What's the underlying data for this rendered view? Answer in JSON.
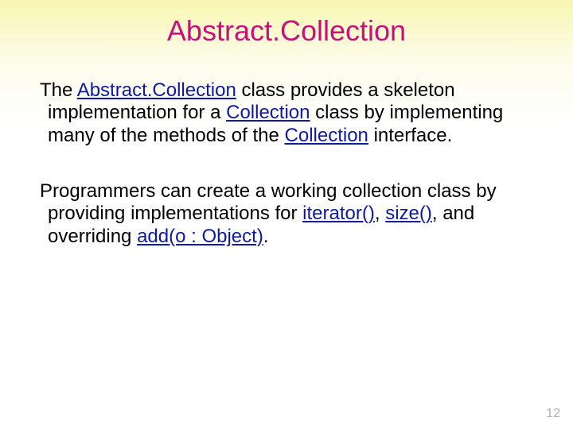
{
  "title": "Abstract.Collection",
  "para1": {
    "t1": "The ",
    "abstractcollection": "Abstract.Collection",
    "t2": " class provides a skeleton implementation for a ",
    "collection1": "Collection",
    "t3": " class by implementing many of the methods of the ",
    "collection2": "Collection",
    "t4": " interface."
  },
  "para2": {
    "t1": "Programmers can create a working collection class by providing implementations for ",
    "iterator": "iterator()",
    "t2": ", ",
    "size": "size()",
    "t3": ", and overriding ",
    "add": "add(o : Object)",
    "t4": "."
  },
  "pageNumber": "12"
}
